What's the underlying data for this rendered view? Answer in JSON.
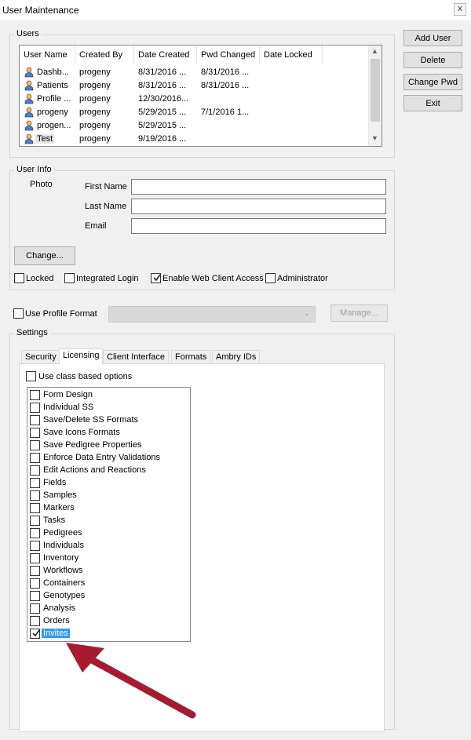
{
  "window": {
    "title": "User Maintenance",
    "close_glyph": "x"
  },
  "users_group": {
    "legend": "Users",
    "columns": [
      "User Name",
      "Created By",
      "Date Created",
      "Pwd Changed",
      "Date Locked"
    ],
    "rows": [
      {
        "name": "Dashb...",
        "created_by": "progeny",
        "date_created": "8/31/2016 ...",
        "pwd_changed": "8/31/2016 ...",
        "date_locked": ""
      },
      {
        "name": "Patients",
        "created_by": "progeny",
        "date_created": "8/31/2016 ...",
        "pwd_changed": "8/31/2016 ...",
        "date_locked": ""
      },
      {
        "name": "Profile ...",
        "created_by": "progeny",
        "date_created": "12/30/2016...",
        "pwd_changed": "",
        "date_locked": ""
      },
      {
        "name": "progeny",
        "created_by": "progeny",
        "date_created": "5/29/2015 ...",
        "pwd_changed": "7/1/2016 1...",
        "date_locked": ""
      },
      {
        "name": "progen...",
        "created_by": "progeny",
        "date_created": "5/29/2015 ...",
        "pwd_changed": "",
        "date_locked": ""
      },
      {
        "name": "Test",
        "created_by": "progeny",
        "date_created": "9/19/2016 ...",
        "pwd_changed": "",
        "date_locked": ""
      }
    ]
  },
  "side_buttons": {
    "add_user": "Add User",
    "delete": "Delete",
    "change_pwd": "Change Pwd",
    "exit": "Exit"
  },
  "user_info": {
    "legend": "User Info",
    "photo_label": "Photo",
    "first_name_label": "First Name",
    "last_name_label": "Last Name",
    "email_label": "Email",
    "first_name_value": "",
    "last_name_value": "",
    "email_value": "",
    "change_button": "Change...",
    "locked": {
      "label": "Locked",
      "checked": false
    },
    "integrated_login": {
      "label": "Integrated Login",
      "checked": false
    },
    "enable_web": {
      "label": "Enable Web Client Access",
      "checked": true
    },
    "administrator": {
      "label": "Administrator",
      "checked": false
    }
  },
  "profile": {
    "use_profile_format": {
      "label": "Use Profile Format",
      "checked": false
    },
    "manage_button": "Manage...",
    "format_value": ""
  },
  "settings": {
    "legend": "Settings",
    "tabs": [
      "Security",
      "Licensing",
      "Client Interface",
      "Formats",
      "Ambry IDs"
    ],
    "active_tab": "Licensing",
    "use_class_based": {
      "label": "Use class based options",
      "checked": false
    },
    "options": [
      {
        "label": "Form Design",
        "checked": false
      },
      {
        "label": "Individual SS",
        "checked": false
      },
      {
        "label": "Save/Delete SS Formats",
        "checked": false
      },
      {
        "label": "Save Icons Formats",
        "checked": false
      },
      {
        "label": "Save Pedigree Properties",
        "checked": false
      },
      {
        "label": "Enforce Data Entry Validations",
        "checked": false
      },
      {
        "label": "Edit Actions and Reactions",
        "checked": false
      },
      {
        "label": "Fields",
        "checked": false
      },
      {
        "label": "Samples",
        "checked": false
      },
      {
        "label": "Markers",
        "checked": false
      },
      {
        "label": "Tasks",
        "checked": false
      },
      {
        "label": "Pedigrees",
        "checked": false
      },
      {
        "label": "Individuals",
        "checked": false
      },
      {
        "label": "Inventory",
        "checked": false
      },
      {
        "label": "Workflows",
        "checked": false
      },
      {
        "label": "Containers",
        "checked": false
      },
      {
        "label": "Genotypes",
        "checked": false
      },
      {
        "label": "Analysis",
        "checked": false
      },
      {
        "label": "Orders",
        "checked": false
      },
      {
        "label": "Invites",
        "checked": true,
        "selected": true
      }
    ]
  },
  "colors": {
    "accent_selection": "#3399ff",
    "annotation_arrow": "#a51c30"
  }
}
